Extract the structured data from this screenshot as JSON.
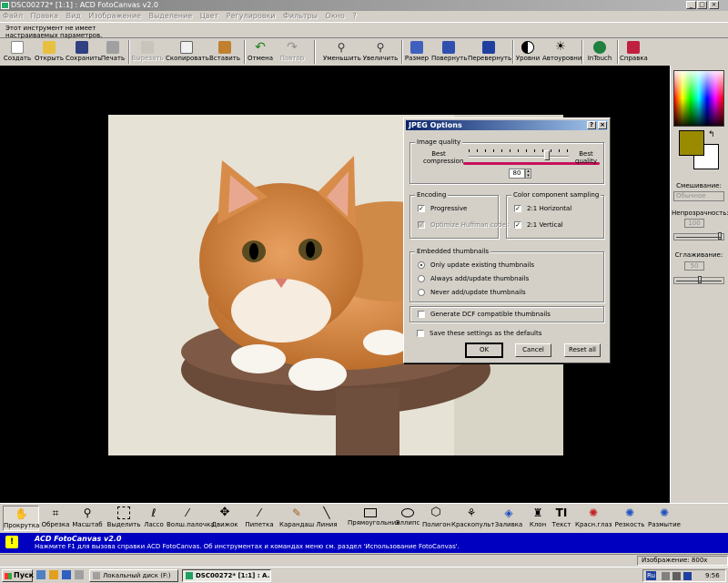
{
  "window": {
    "title": "DSC00272* [1:1] : ACD FotoCanvas v2.0",
    "minimize": "_",
    "maximize": "□",
    "close": "×"
  },
  "menu": [
    "Файл",
    "Правка",
    "Вид",
    "Изображение",
    "Выделение",
    "Цвет",
    "Регулировки",
    "Фильтры",
    "Окно",
    "?"
  ],
  "hint": {
    "line1": "Этот инструмент не имеет",
    "line2": "настраиваемых параметров."
  },
  "toolbar": {
    "new": "Создать",
    "open": "Открыть",
    "save": "Сохранить",
    "print": "Печать",
    "cut": "Вырезать",
    "copy": "Скопировать",
    "paste": "Вставить",
    "undo": "Отмена",
    "redo": "Повтор",
    "zoom_out": "Уменьшить",
    "zoom_in": "Увеличить",
    "resize": "Размер",
    "rotate": "Повернуть",
    "flip": "Перевернуть",
    "levels": "Уровни",
    "auto_levels": "Автоуровни",
    "intouch": "InTouch",
    "help": "Справка"
  },
  "right_panel": {
    "blend_label": "Смешивание:",
    "blend_value": "Обычное",
    "opacity_label": "Непрозрачность:",
    "opacity_value": "100",
    "smoothing_label": "Сглаживание:",
    "smoothing_value": "50",
    "fg_color": "#9a8a00",
    "bg_color": "#ffffff"
  },
  "dialog": {
    "title": "JPEG Options",
    "help_btn": "?",
    "close_btn": "×",
    "image_quality": "Image quality",
    "best_compression": "Best compression",
    "best_quality": "Best quality",
    "quality_value": "80",
    "quality_fraction": 0.8,
    "encoding": "Encoding",
    "progressive": "Progressive",
    "optimize_huffman": "Optimize Huffman codes",
    "sampling": "Color component sampling",
    "horizontal": "2:1 Horizontal",
    "vertical": "2:1 Vertical",
    "embedded": "Embedded thumbnails",
    "only_update": "Only update existing thumbnails",
    "always_add": "Always add/update thumbnails",
    "never_add": "Never add/update thumbnails",
    "generate_dcf": "Generate DCF compatible thumbnails",
    "save_defaults": "Save these settings as the defaults",
    "ok": "OK",
    "cancel": "Cancel",
    "reset": "Reset all"
  },
  "tools": [
    "Прокрутка",
    "Обрезка",
    "Масштаб",
    "Выделить",
    "Лассо",
    "Волш.палочка",
    "Движок",
    "Пипетка",
    "Карандаш",
    "Линия",
    "Прямоугольник",
    "Эллипс",
    "Полигон",
    "Краскопульт",
    "Заливка",
    "Клон",
    "Текст",
    "Красн.глаз",
    "Резкость",
    "Размытие"
  ],
  "infobar": {
    "title": "ACD FotoCanvas v2.0",
    "text": "Нажмите F1 для вызова справки ACD FotoCanvas.  Об инструментах и командах меню см. раздел 'Использование FotoCanvas'."
  },
  "statusbar": {
    "image": "Изображение: 800x"
  },
  "taskbar": {
    "start": "Пуск",
    "task1": "Локальный диск (F:)",
    "task2": "DSC00272* [1:1] : A...",
    "lang": "Ru",
    "time": "9:56"
  }
}
